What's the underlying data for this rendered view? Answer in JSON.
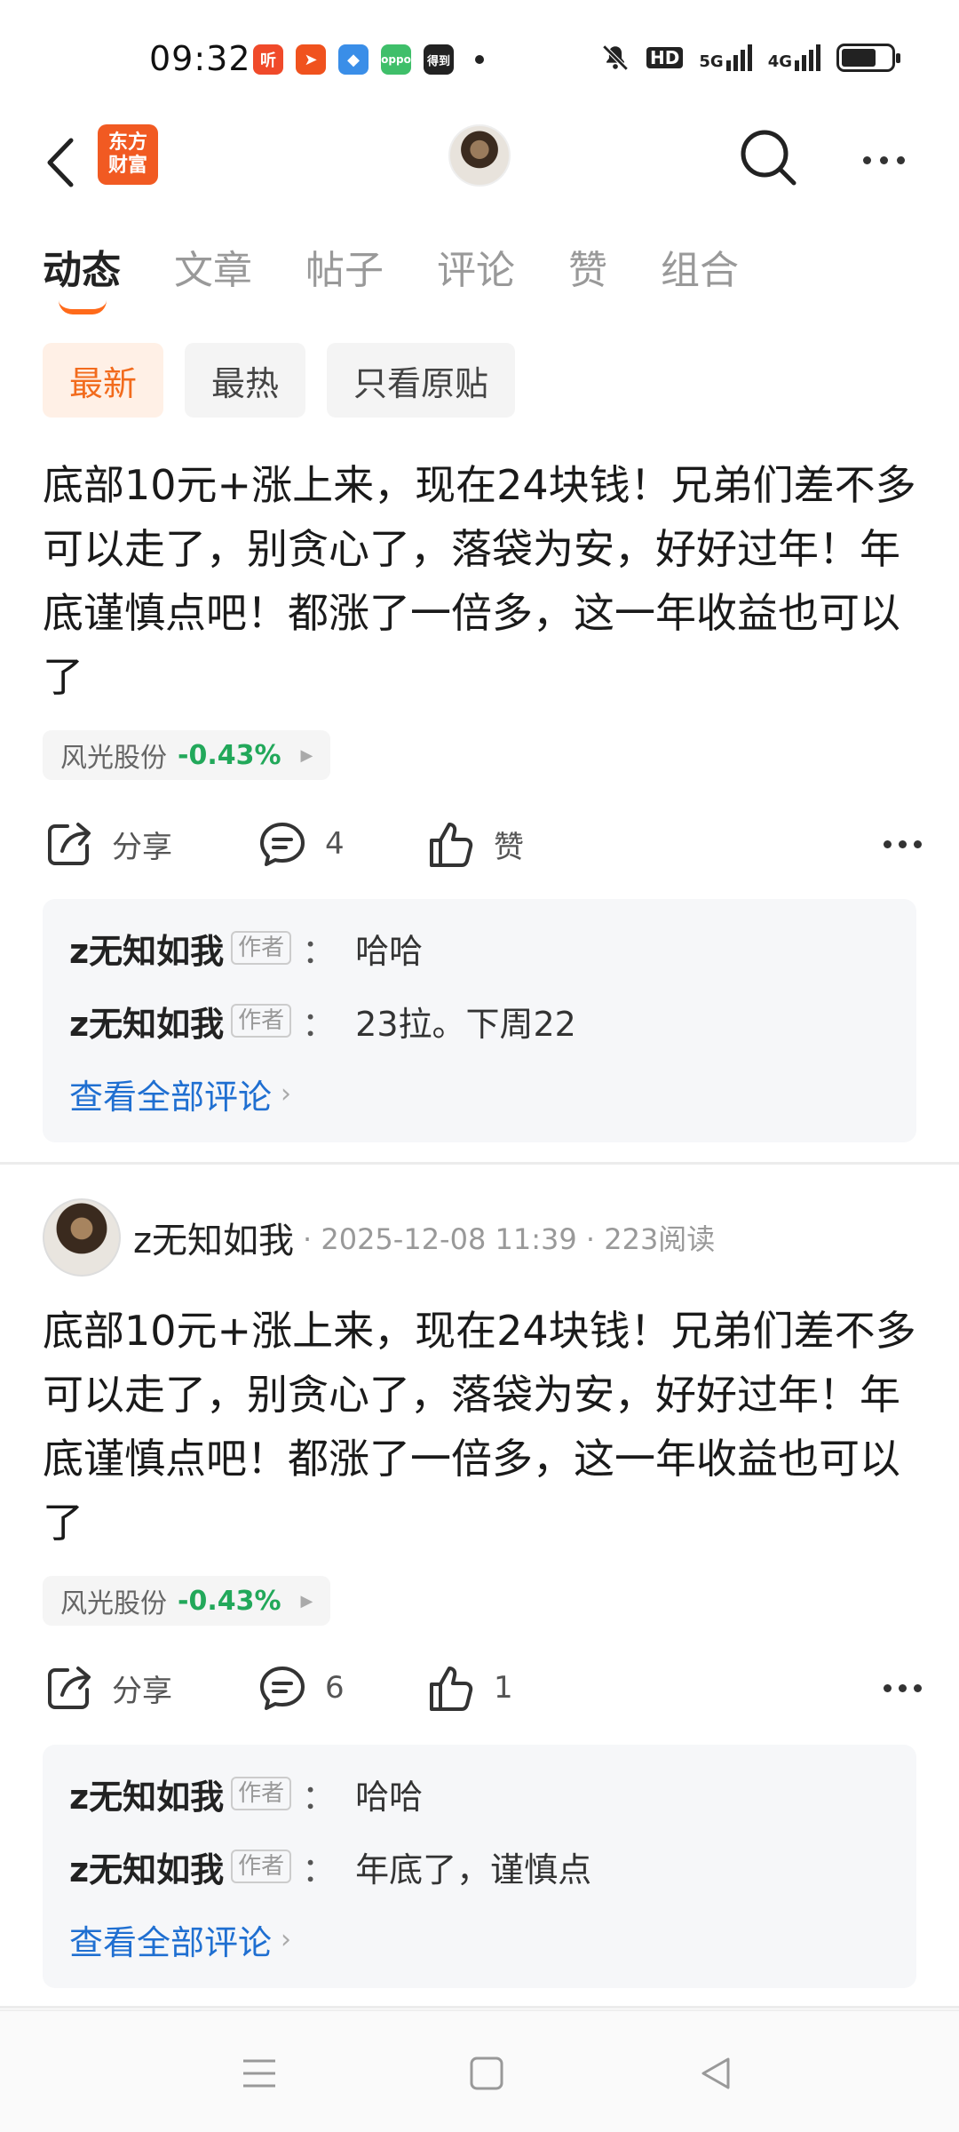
{
  "status_bar": {
    "time": "09:32",
    "apps": [
      {
        "icon": "ting-app-icon",
        "label": "听",
        "color": "#f04a2a"
      },
      {
        "icon": "send-app-icon",
        "label": "➤",
        "color": "#f0521e"
      },
      {
        "icon": "shield-app-icon",
        "label": "◆",
        "color": "#3a8ee8"
      },
      {
        "icon": "oppo-app-icon",
        "label": "oppo",
        "color": "#3fbf6a"
      },
      {
        "icon": "dedao-app-icon",
        "label": "得到",
        "color": "#222222"
      }
    ],
    "icons": [
      "mute-bell-icon",
      "hd-icon",
      "5g-signal-icon",
      "4g-signal-icon",
      "battery-icon"
    ],
    "hd_label": "HD",
    "net1": "5G",
    "net2": "4G"
  },
  "header": {
    "logo_line1": "东方",
    "logo_line2": "财富",
    "brand_color": "#f15a22"
  },
  "tabs": [
    {
      "label": "动态",
      "active": true
    },
    {
      "label": "文章",
      "active": false
    },
    {
      "label": "帖子",
      "active": false
    },
    {
      "label": "评论",
      "active": false
    },
    {
      "label": "赞",
      "active": false
    },
    {
      "label": "组合",
      "active": false
    }
  ],
  "filters": [
    {
      "label": "最新",
      "active": true
    },
    {
      "label": "最热",
      "active": false
    },
    {
      "label": "只看原贴",
      "active": false
    }
  ],
  "posts": [
    {
      "text": "底部10元+涨上来，现在24块钱！兄弟们差不多可以走了，别贪心了，落袋为安，好好过年！年底谨慎点吧！都涨了一倍多，这一年收益也可以了",
      "stock_name": "风光股份",
      "stock_change": "-0.43%",
      "share_label": "分享",
      "comment_count": "4",
      "like_label": "赞",
      "comments": [
        {
          "user": "z无知如我",
          "badge": "作者",
          "colon": "：",
          "text": "哈哈"
        },
        {
          "user": "z无知如我",
          "badge": "作者",
          "colon": "：",
          "text": "23拉。下周22"
        }
      ],
      "view_all": "查看全部评论"
    },
    {
      "author": "z无知如我",
      "meta": "· 2025-12-08 11:39 · 223阅读",
      "text": "底部10元+涨上来，现在24块钱！兄弟们差不多可以走了，别贪心了，落袋为安，好好过年！年底谨慎点吧！都涨了一倍多，这一年收益也可以了",
      "stock_name": "风光股份",
      "stock_change": "-0.43%",
      "share_label": "分享",
      "comment_count": "6",
      "like_label": "1",
      "comments": [
        {
          "user": "z无知如我",
          "badge": "作者",
          "colon": "：",
          "text": "哈哈"
        },
        {
          "user": "z无知如我",
          "badge": "作者",
          "colon": "：",
          "text": "年底了，谨慎点"
        }
      ],
      "view_all": "查看全部评论"
    }
  ],
  "colors": {
    "accent": "#f26b1d",
    "link": "#1f6fd1",
    "stock_down": "#22a85a"
  }
}
